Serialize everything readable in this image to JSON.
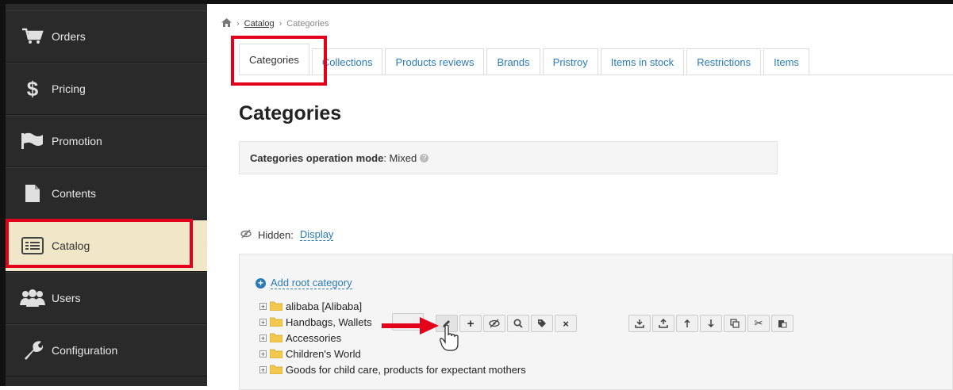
{
  "sidebar": {
    "items": [
      {
        "label": "Orders",
        "icon": "cart-icon"
      },
      {
        "label": "Pricing",
        "icon": "dollar-icon"
      },
      {
        "label": "Promotion",
        "icon": "flag-icon"
      },
      {
        "label": "Contents",
        "icon": "document-icon"
      },
      {
        "label": "Catalog",
        "icon": "list-icon"
      },
      {
        "label": "Users",
        "icon": "users-icon"
      },
      {
        "label": "Configuration",
        "icon": "wrench-icon"
      }
    ],
    "active": "Catalog"
  },
  "breadcrumb": {
    "home_icon": "home-icon",
    "link": "Catalog",
    "current": "Categories"
  },
  "tabs": [
    "Categories",
    "Collections",
    "Products reviews",
    "Brands",
    "Pristroy",
    "Items in stock",
    "Restrictions",
    "Items"
  ],
  "active_tab": "Categories",
  "page_title": "Categories",
  "mode": {
    "label": "Categories operation mode",
    "value": ": Mixed"
  },
  "hidden": {
    "label": "Hidden:",
    "link": "Display"
  },
  "tree": {
    "add_root": "Add root category",
    "rows": [
      "alibaba [Alibaba]",
      "Handbags, Wallets",
      "Accessories",
      "Children's World",
      "Goods for child care, products for expectant mothers"
    ]
  },
  "toolbar_icons": {
    "group1": [
      "pencil-icon",
      "plus-icon",
      "eye-slash-icon",
      "search-icon",
      "tag-icon",
      "close-icon"
    ],
    "group2": [
      "import-icon",
      "export-icon",
      "arrow-up-icon",
      "arrow-down-icon",
      "copy-icon",
      "cut-icon",
      "paste-icon"
    ]
  },
  "colors": {
    "sidebar_bg": "#2a2a2a",
    "active_item": "#f0e6c8",
    "link": "#2a7ab8",
    "highlight": "#e3001b"
  }
}
